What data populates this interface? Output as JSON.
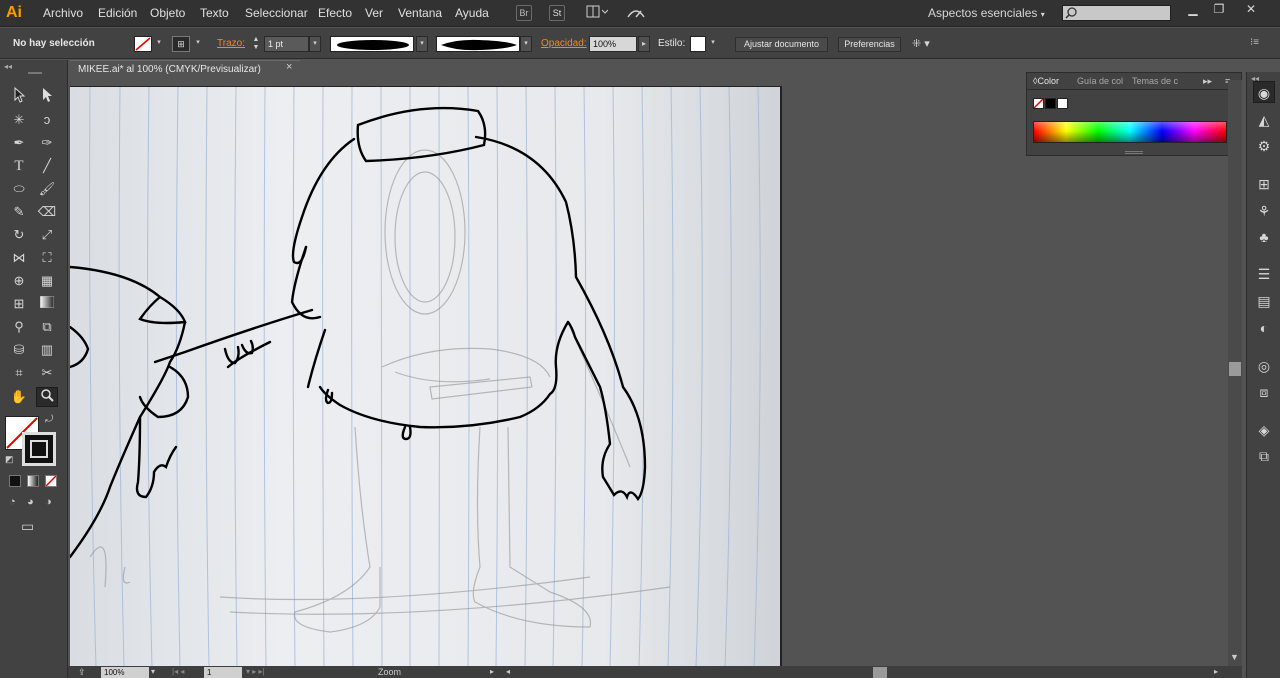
{
  "app": {
    "logo": "Ai",
    "accent_color": "#ff9a00"
  },
  "menubar": {
    "items": [
      "Archivo",
      "Edición",
      "Objeto",
      "Texto",
      "Seleccionar",
      "Efecto",
      "Ver",
      "Ventana",
      "Ayuda"
    ],
    "bridge_label": "Br",
    "stock_label": "St",
    "workspace": "Aspectos esenciales",
    "search_placeholder": ""
  },
  "controlbar": {
    "selection_status": "No hay selección",
    "stroke_label": "Trazo:",
    "stroke_weight": "1 pt",
    "opacity_label": "Opacidad:",
    "opacity_value": "100%",
    "style_label": "Estilo:",
    "fit_document_button": "Ajustar documento",
    "preferences_button": "Preferencias"
  },
  "document": {
    "tab_title": "MIKEE.ai* al 100% (CMYK/Previsualizar)",
    "close_glyph": "×"
  },
  "color_panel": {
    "tabs": [
      "Color",
      "Guía de col",
      "Temas de c"
    ],
    "expand_glyph": "▸▸",
    "menu_glyph": "≡"
  },
  "statusbar": {
    "zoom": "100%",
    "artboard_number": "1",
    "tool_name": "Zoom"
  },
  "tools": [
    "selection-tool",
    "direct-selection-tool",
    "magic-wand-tool",
    "lasso-tool",
    "pen-tool",
    "curvature-tool",
    "type-tool",
    "line-tool",
    "ellipse-tool",
    "paintbrush-tool",
    "pencil-tool",
    "eraser-tool",
    "rotate-tool",
    "scale-tool",
    "width-tool",
    "free-transform-tool",
    "shape-builder-tool",
    "perspective-grid-tool",
    "mesh-tool",
    "gradient-tool",
    "eyedropper-tool",
    "blend-tool",
    "symbol-sprayer-tool",
    "graph-tool",
    "artboard-tool",
    "slice-tool",
    "hand-tool",
    "zoom-tool"
  ],
  "dock_icons": [
    "color-guide-icon",
    "swatches-icon",
    "brushes-icon",
    "grid-icon",
    "symbols-icon",
    "club-icon",
    "stroke-icon",
    "gradient-icon",
    "transparency-icon",
    "appearance-icon",
    "align-icon",
    "layers-icon",
    "artboards-icon"
  ]
}
